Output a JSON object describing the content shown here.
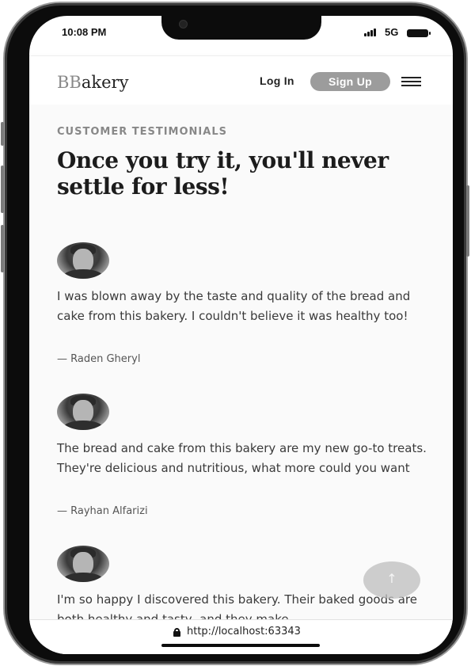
{
  "status_bar": {
    "time": "10:08 PM",
    "network": "5G"
  },
  "navbar": {
    "logo_prefix": "BB",
    "logo_suffix": "akery",
    "login_label": "Log In",
    "signup_label": "Sign Up"
  },
  "section": {
    "eyebrow": "CUSTOMER TESTIMONIALS",
    "headline": "Once you try it, you'll never settle for less!"
  },
  "testimonials": [
    {
      "quote": "I was blown away by the taste and quality of the bread and cake from this bakery. I couldn't believe it was healthy too!",
      "author": "— Raden Gheryl"
    },
    {
      "quote": "The bread and cake from this bakery are my new go-to treats. They're delicious and nutritious, what more could you want",
      "author": "— Rayhan Alfarizi"
    },
    {
      "quote": "I'm so happy I discovered this bakery. Their baked goods are both healthy and tasty, and they make",
      "author": ""
    }
  ],
  "scroll_top_icon": "arrow-up-icon",
  "browser": {
    "url": "http://localhost:63343"
  },
  "colors": {
    "accent_button": "#9c9c9c",
    "frame": "#0c0c0c"
  }
}
